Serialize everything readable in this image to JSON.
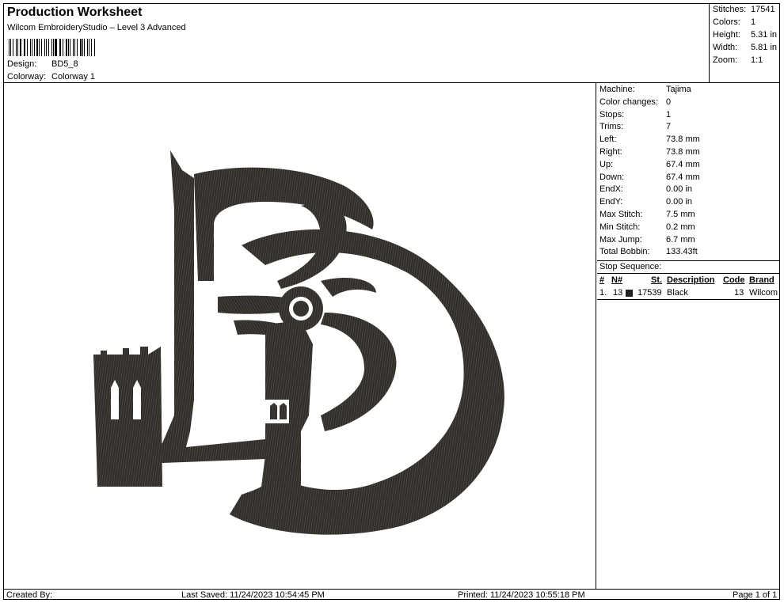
{
  "header": {
    "title": "Production Worksheet",
    "subtitle": "Wilcom EmbroideryStudio – Level 3 Advanced",
    "design_label": "Design:",
    "design_value": "BD5_8",
    "colorway_label": "Colorway:",
    "colorway_value": "Colorway 1"
  },
  "summary": {
    "stitches_label": "Stitches:",
    "stitches_value": "17541",
    "colors_label": "Colors:",
    "colors_value": "1",
    "height_label": "Height:",
    "height_value": "5.31 in",
    "width_label": "Width:",
    "width_value": "5.81 in",
    "zoom_label": "Zoom:",
    "zoom_value": "1:1"
  },
  "stats": [
    {
      "label": "Machine:",
      "value": "Tajima"
    },
    {
      "label": "Color changes:",
      "value": "0"
    },
    {
      "label": "Stops:",
      "value": "1"
    },
    {
      "label": "Trims:",
      "value": "7"
    },
    {
      "label": "Left:",
      "value": "73.8 mm"
    },
    {
      "label": "Right:",
      "value": "73.8 mm"
    },
    {
      "label": "Up:",
      "value": "67.4 mm"
    },
    {
      "label": "Down:",
      "value": "67.4 mm"
    },
    {
      "label": "EndX:",
      "value": "0.00 in"
    },
    {
      "label": "EndY:",
      "value": "0.00 in"
    },
    {
      "label": "Max Stitch:",
      "value": "7.5 mm"
    },
    {
      "label": "Min Stitch:",
      "value": "0.2 mm"
    },
    {
      "label": "Max Jump:",
      "value": "6.7 mm"
    },
    {
      "label": "Total Bobbin:",
      "value": "133.43ft"
    }
  ],
  "stop_sequence": {
    "title": "Stop Sequence:",
    "headers": {
      "num": "#",
      "needle": "N#",
      "stitches": "St.",
      "description": "Description",
      "code": "Code",
      "brand": "Brand"
    },
    "rows": [
      {
        "num": "1.",
        "needle": "13",
        "swatch_color": "#222222",
        "stitches": "17539",
        "description": "Black",
        "code": "13",
        "brand": "Wilcom"
      }
    ]
  },
  "footer": {
    "created_by": "Created By:",
    "last_saved": "Last Saved: 11/24/2023 10:54:45 PM",
    "printed": "Printed: 11/24/2023 10:55:18 PM",
    "page": "Page 1 of 1"
  },
  "colors": {
    "thread": "#2f2c29",
    "thread_light": "#4a4540",
    "background": "#ffffff"
  }
}
